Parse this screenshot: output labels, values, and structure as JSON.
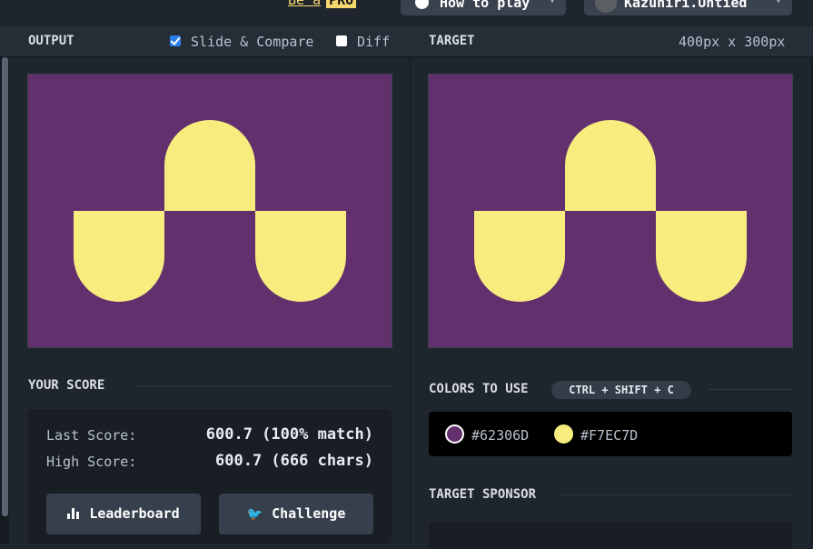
{
  "top": {
    "pro_link_text": "Be a",
    "pro_badge": "PRO",
    "how_to_play": "How to play",
    "username": "Kazuhiri.Untied"
  },
  "header": {
    "output_label": "OUTPUT",
    "slide_compare_label": "Slide & Compare",
    "slide_compare_checked": true,
    "diff_label": "Diff",
    "diff_checked": false,
    "target_label": "TARGET",
    "target_dims": "400px x 300px"
  },
  "score": {
    "section_title": "YOUR SCORE",
    "last_label": "Last Score:",
    "last_value": "600.7 (100% match)",
    "high_label": "High Score:",
    "high_value": "600.7 (666 chars)",
    "leaderboard_label": "Leaderboard",
    "challenge_label": "Challenge"
  },
  "colors": {
    "section_title": "COLORS TO USE",
    "shortcut": "CTRL + SHIFT + C",
    "swatches": [
      {
        "hex": "#62306D"
      },
      {
        "hex": "#F7EC7D"
      }
    ]
  },
  "sponsor": {
    "section_title": "TARGET SPONSOR"
  },
  "palette": {
    "background": "#62306d",
    "shape": "#f7ec7d",
    "accent": "#2b7de9"
  }
}
